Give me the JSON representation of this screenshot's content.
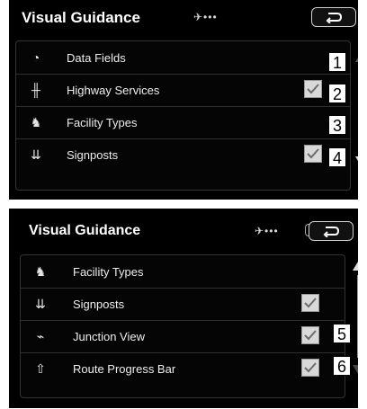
{
  "screens": [
    {
      "title": "Visual Guidance",
      "status": "✈•••",
      "back_icon": "return-icon",
      "items": [
        {
          "label": "Data Fields",
          "icon": "speedometer-icon",
          "checked": false,
          "callout": "1"
        },
        {
          "label": "Highway Services",
          "icon": "highway-icon",
          "checked": true,
          "callout": "2"
        },
        {
          "label": "Facility Types",
          "icon": "facility-icon",
          "checked": false,
          "callout": "3"
        },
        {
          "label": "Signposts",
          "icon": "signpost-icon",
          "checked": true,
          "callout": "4"
        }
      ]
    },
    {
      "title": "Visual Guidance",
      "status": "✈•••",
      "back_icon": "return-icon",
      "items": [
        {
          "label": "Facility Types",
          "icon": "facility-icon",
          "checked": false,
          "callout": ""
        },
        {
          "label": "Signposts",
          "icon": "signpost-icon",
          "checked": true,
          "callout": ""
        },
        {
          "label": "Junction View",
          "icon": "junction-icon",
          "checked": true,
          "callout": "5"
        },
        {
          "label": "Route Progress Bar",
          "icon": "route-progress-icon",
          "checked": true,
          "callout": "6"
        }
      ]
    }
  ]
}
